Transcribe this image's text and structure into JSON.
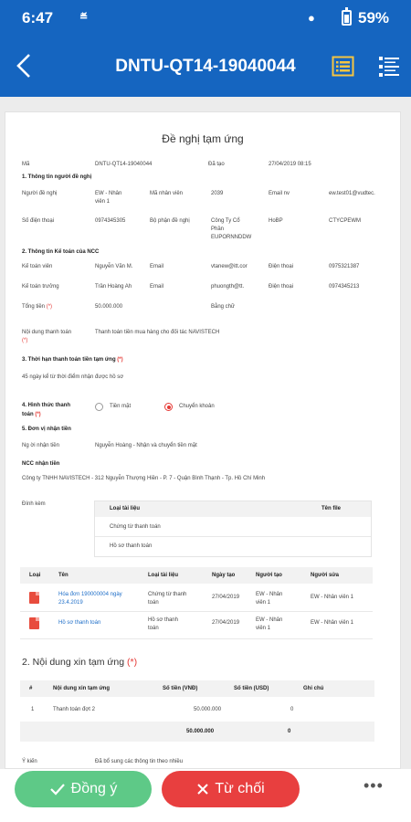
{
  "status": {
    "time": "6:47",
    "notification_icon": "news-icon",
    "battery": "59%"
  },
  "appbar": {
    "title": "DNTU-QT14-19040044"
  },
  "doc": {
    "title": "Đề nghị tạm ứng",
    "ma_label": "Mã",
    "ma_value": "DNTU-QT14-19040044",
    "da_tao_label": "Đã tạo",
    "da_tao_value": "27/04/2019 08:15",
    "s1": "1. Thông tin người đề nghị",
    "nguoi_de_nghi_label": "Người đề nghị",
    "nguoi_de_nghi_value": "EW - Nhân",
    "nguoi_de_nghi_value2": "viên 1",
    "ma_nv_label": "Mã nhân viên",
    "ma_nv_value": "2039",
    "email_label": "Email nv",
    "email_value": "ew.test01@vudtec.",
    "sdt_label": "Số điện thoại",
    "sdt_value": "0974345305",
    "bophan_label": "Bộ phận đề nghị",
    "bophan_value": "Công Ty Cổ",
    "bophan_value2": "Phần",
    "bophan_value3": "EUPORNNDDW",
    "hobp_label": "HoBP",
    "hobp_value": "CTYCPEWM",
    "s2": "2. Thông tin Kế toán của NCC",
    "ktbv_label": "Kế toán viên",
    "ktbv_value": "Nguyễn Văn M.",
    "email2_label": "Email",
    "email2_value": "vtanew@itt.cor",
    "dt1_label": "Điện thoại",
    "dt1_value": "0975321387",
    "ktt_label": "Kế toán trưởng",
    "ktt_value": "Trần Hoàng Ah",
    "email3_label": "Email",
    "email3_value": "phuongth@tt.",
    "dt2_label": "Điện thoại",
    "dt2_value": "0974345213",
    "tongtien_label": "Tổng tiền",
    "tongtien_value": "50.000.000",
    "bangchu_label": "Bằng chữ",
    "noidung_label": "Nội dung thanh toán",
    "noidung_value": "Thanh toán tiền mua hàng cho đối tác NAVISTECH",
    "s3": "3. Thời hạn thanh toán tiền tạm ứng",
    "s3_value": "45 ngày kể từ thời điểm nhận được hồ sơ",
    "s4a": "4. Hình thức thanh",
    "s4b": "toán",
    "opt_cash": "Tiền mặt",
    "opt_transfer": "Chuyển khoản",
    "s5": "5. Đơn vị nhận tiền",
    "nguoi_nhan_label": "Ng ời nhận tiền",
    "nguoi_nhan_value": "Nguyễn Hoàng - Nhận và chuyển tiền mặt",
    "ncc_label": "NCC nhận tiền",
    "ncc_value": "Công ty TNHH NAVISTECH - 312 Nguyễn Thượng Hiền - P. 7 - Quận Bình Thạnh - Tp. Hồ Chí Minh",
    "dinhkem_label": "Đính kèm",
    "att_col1": "Loại tài liệu",
    "att_col2": "Tên file",
    "att_rows": [
      "Chứng từ thanh toán",
      "Hồ sơ thanh toán"
    ],
    "files_cols": [
      "Loại",
      "Tên",
      "Loại tài liệu",
      "Ngày tạo",
      "Người tạo",
      "Người sửa"
    ],
    "files": [
      {
        "name": "Hóa đơn 190000004 ngày",
        "name2": "23.4.2019",
        "type": "Chứng từ thanh",
        "type2": "toán",
        "date": "27/04/2019",
        "creator": "EW - Nhân",
        "creator2": "viên 1",
        "editor": "EW - Nhân viên 1"
      },
      {
        "name": "Hồ sơ thanh toán",
        "name2": "",
        "type": "Hồ sơ thanh",
        "type2": "toán",
        "date": "27/04/2019",
        "creator": "EW - Nhân",
        "creator2": "viên 1",
        "editor": "EW - Nhân viên 1"
      }
    ],
    "sec2_title": "2. Nội dung xin tạm ứng",
    "sec2_req": "(*)",
    "tbl_cols": [
      "#",
      "Nội dung xin tạm ứng",
      "Số tiền (VNĐ)",
      "Số tiền (USD)",
      "Ghi chú"
    ],
    "tbl_row": {
      "no": "1",
      "content": "Thanh toán đợt 2",
      "vnd": "50.000.000",
      "usd": "0"
    },
    "tbl_sum": {
      "vnd": "50.000.000",
      "usd": "0"
    },
    "footer_label": "Ý kiến",
    "footer_value": "Đã bổ sung các thông tin theo nhiều"
  },
  "actions": {
    "accept": "Đồng ý",
    "reject": "Từ chối",
    "more": "•••"
  },
  "colors": {
    "primary": "#1565c0",
    "accept": "#5ec987",
    "reject": "#e83f3f",
    "required": "#e53935",
    "link": "#1e6ec8"
  }
}
